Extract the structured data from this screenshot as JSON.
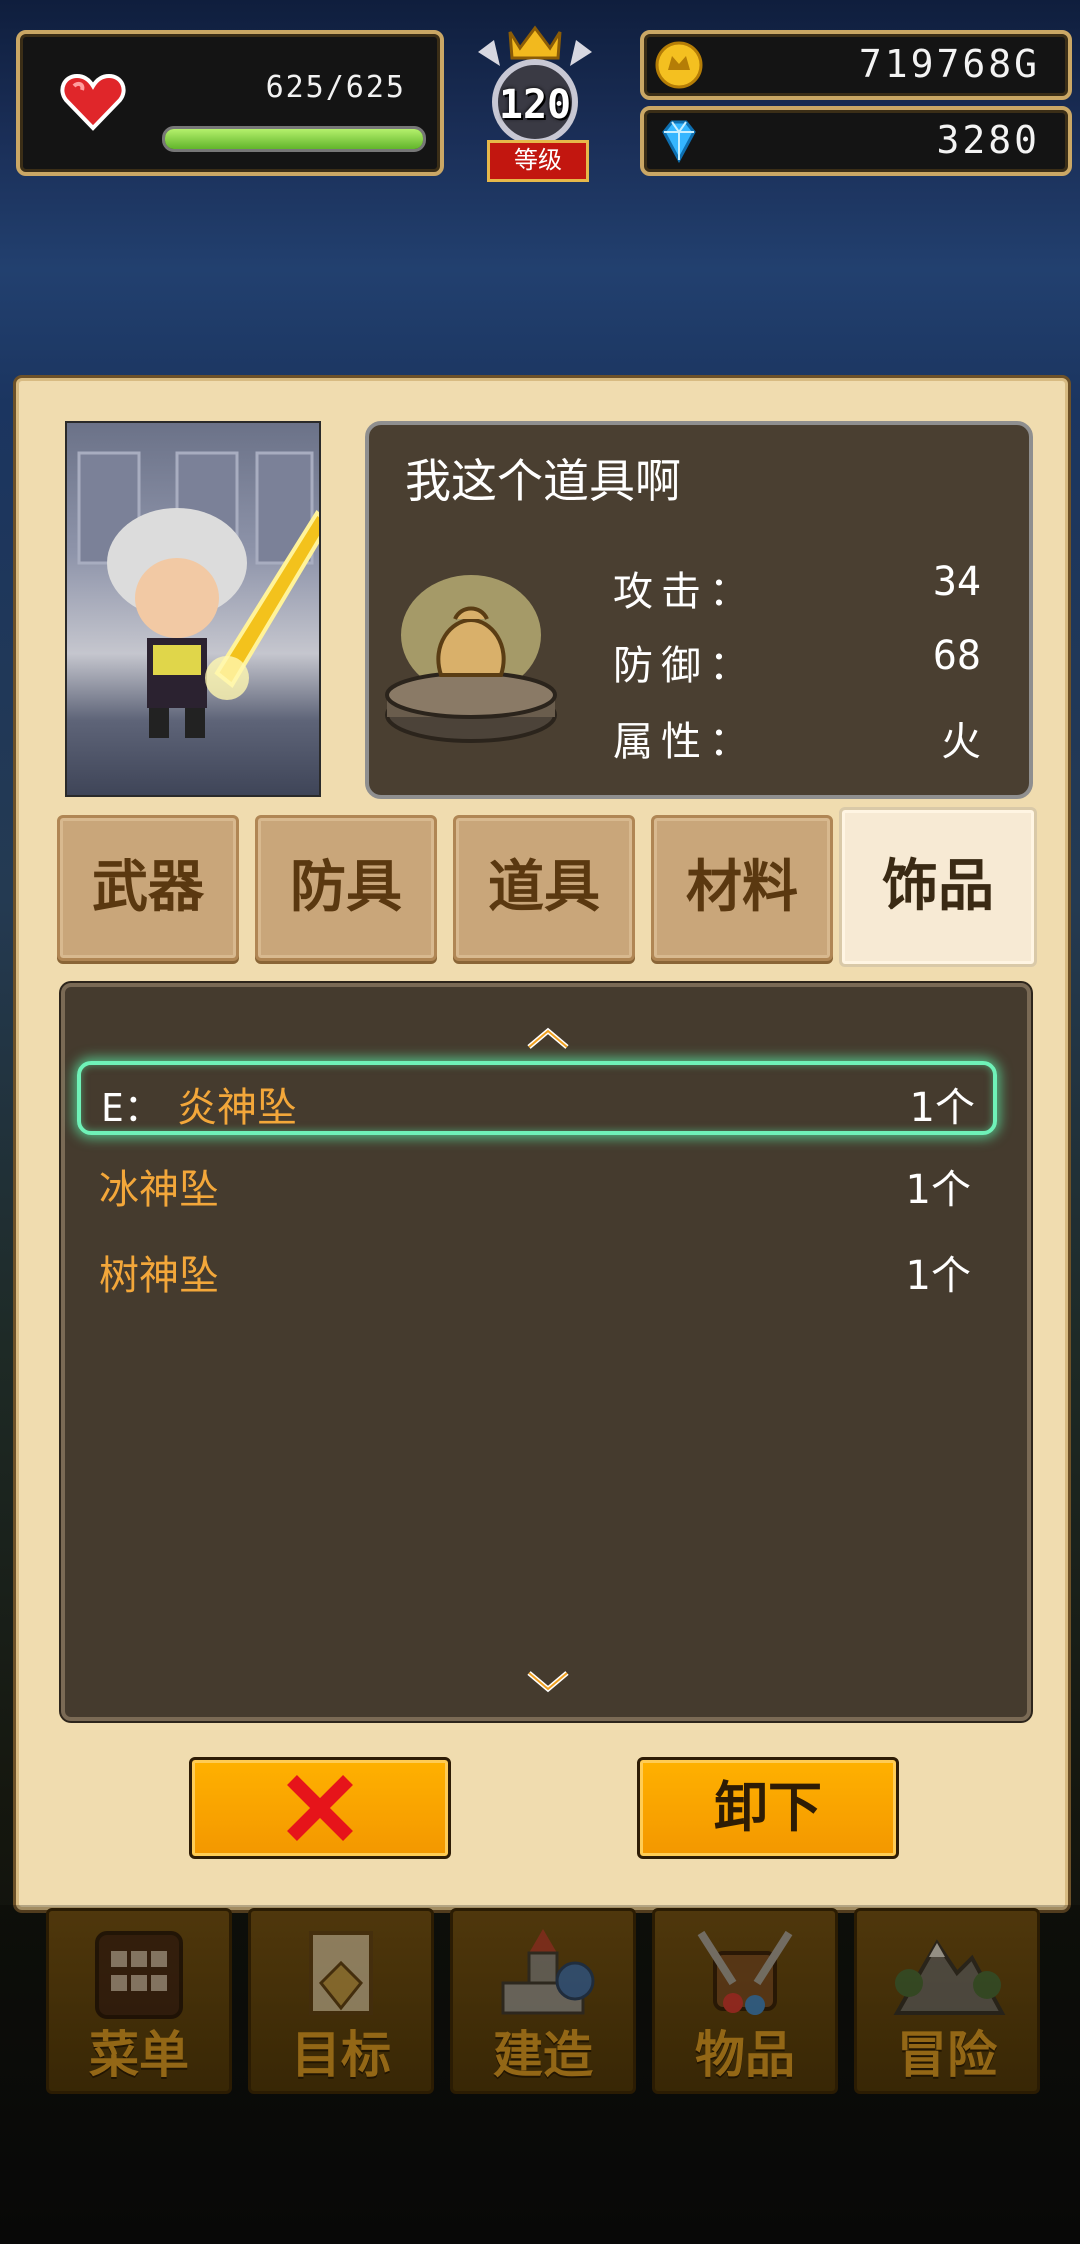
{
  "hud": {
    "hp_text": "625/625",
    "hp_fraction": 1.0,
    "level": "120",
    "level_label": "等级",
    "gold": "719768G",
    "gems": "3280"
  },
  "item_detail": {
    "title": "我这个道具啊",
    "stats": [
      {
        "label": "攻击：",
        "value": "34"
      },
      {
        "label": "防御：",
        "value": "68"
      },
      {
        "label": "属性：",
        "value": "火"
      }
    ]
  },
  "tabs": [
    {
      "label": "武器",
      "active": false
    },
    {
      "label": "防具",
      "active": false
    },
    {
      "label": "道具",
      "active": false
    },
    {
      "label": "材料",
      "active": false
    },
    {
      "label": "饰品",
      "active": true
    }
  ],
  "items": [
    {
      "prefix": "E：",
      "name": "炎神坠",
      "count": "1个",
      "selected": true
    },
    {
      "prefix": "",
      "name": "冰神坠",
      "count": "1个",
      "selected": false
    },
    {
      "prefix": "",
      "name": "树神坠",
      "count": "1个",
      "selected": false
    }
  ],
  "buttons": {
    "close_icon": "red-x-icon",
    "unequip_label": "卸下"
  },
  "bottom_nav": [
    {
      "label": "菜单",
      "icon": "grid-menu-icon"
    },
    {
      "label": "目标",
      "icon": "quest-scroll-icon"
    },
    {
      "label": "建造",
      "icon": "castle-icon"
    },
    {
      "label": "物品",
      "icon": "item-bag-icon"
    },
    {
      "label": "冒险",
      "icon": "mountain-icon"
    }
  ],
  "colors": {
    "accent_orange": "#f3a73a",
    "selection_glow": "#6ff2b8",
    "button_orange": "#ffa800",
    "hp_green": "#7fd23a"
  }
}
